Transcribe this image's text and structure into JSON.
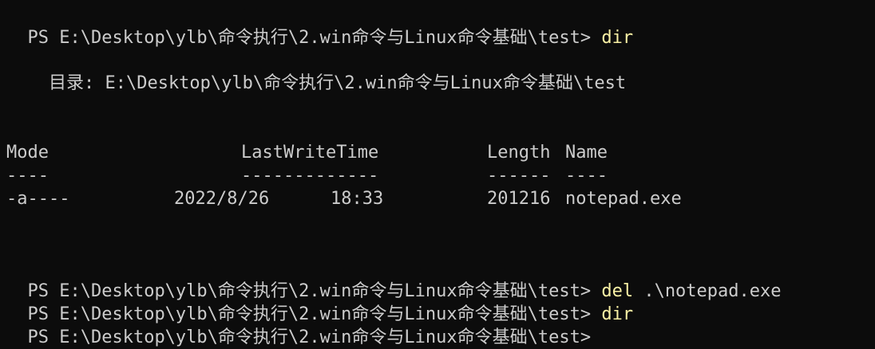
{
  "terminal": {
    "prompt": "PS E:\\Desktop\\ylb\\命令执行\\2.win命令与Linux命令基础\\test> ",
    "commands": [
      {
        "cmd": "dir",
        "arg": ""
      },
      {
        "cmd": "del",
        "arg": " .\\notepad.exe"
      },
      {
        "cmd": "dir",
        "arg": ""
      }
    ],
    "directory_line": "    目录: E:\\Desktop\\ylb\\命令执行\\2.win命令与Linux命令基础\\test",
    "table": {
      "headers": {
        "mode": "Mode",
        "lastwrite": "LastWriteTime",
        "length": "Length",
        "name": "Name"
      },
      "underlines": {
        "mode": "----",
        "lastwrite": "-------------",
        "length": "------",
        "name": "----"
      },
      "rows": [
        {
          "mode": "-a----",
          "date": "2022/8/26",
          "time": "18:33",
          "length": "201216",
          "name": "notepad.exe"
        }
      ]
    }
  },
  "colors": {
    "background": "#0c0c0c",
    "text": "#cccccc",
    "command": "#f9f1a5"
  }
}
